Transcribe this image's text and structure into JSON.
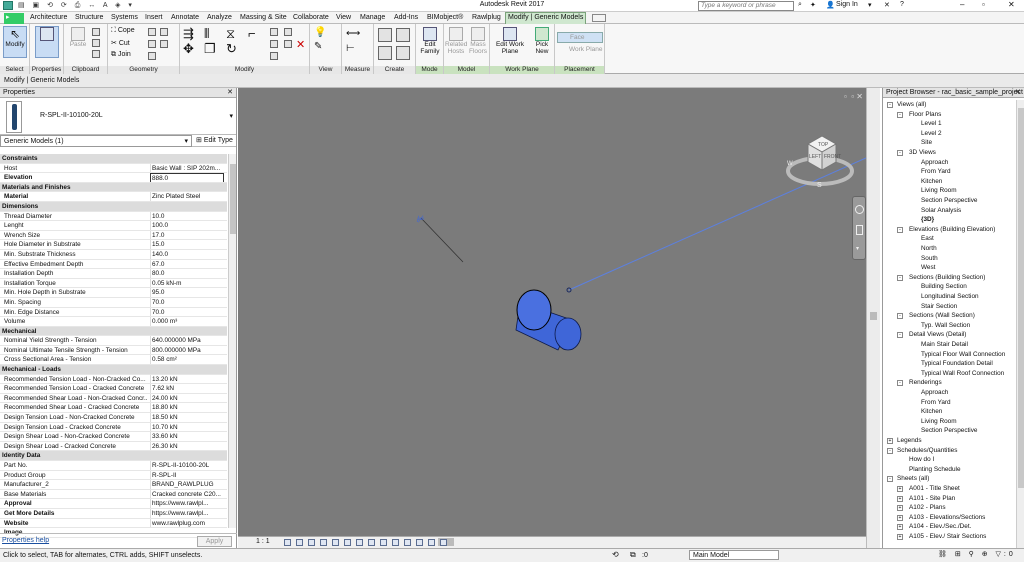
{
  "app_title": "Autodesk Revit 2017",
  "search_placeholder": "Type a keyword or phrase",
  "sign_in": "Sign In",
  "tabs": [
    "Architecture",
    "Structure",
    "Systems",
    "Insert",
    "Annotate",
    "Analyze",
    "Massing & Site",
    "Collaborate",
    "View",
    "Manage",
    "Add-Ins",
    "BIMobject®",
    "Rawlplug",
    "Modify | Generic Models"
  ],
  "ribbon": {
    "select_label": "Select",
    "modify_label": "Modify",
    "properties_label": "Properties",
    "paste_label": "Paste",
    "clipboard_label": "Clipboard",
    "cope_label": "Cope",
    "cut_label": "Cut",
    "join_label": "Join",
    "geometry_label": "Geometry",
    "modify_group_label": "Modify",
    "view_label": "View",
    "measure_label": "Measure",
    "create_label": "Create",
    "edit_family_label": "Edit Family",
    "mode_label": "Mode",
    "related_hosts_label": "Related Hosts",
    "mass_floors_label": "Mass Floors",
    "model_label": "Model",
    "edit_work_plane_label": "Edit Work Plane",
    "work_plane_label": "Work Plane",
    "pick_new_label": "Pick New",
    "face_label": "Face",
    "work_plane_opt_label": "Work Plane",
    "placement_label": "Placement"
  },
  "context_bar": "Modify | Generic Models",
  "properties": {
    "title": "Properties",
    "type_name": "R-SPL-II-10100-20L",
    "filter": "Generic Models (1)",
    "edit_type": "Edit Type",
    "rows": [
      {
        "k": "Constraints",
        "sec": true
      },
      {
        "k": "Host",
        "v": "Basic Wall : SIP 202m..."
      },
      {
        "k": "Elevation",
        "v": "888.0",
        "bold": true
      },
      {
        "k": "Materials and Finishes",
        "sec": true
      },
      {
        "k": "Material",
        "v": "Zinc Plated Steel",
        "bold": true
      },
      {
        "k": "Dimensions",
        "sec": true
      },
      {
        "k": "Thread Diameter",
        "v": "10.0"
      },
      {
        "k": "Lenght",
        "v": "100.0"
      },
      {
        "k": "Wrench Size",
        "v": "17.0"
      },
      {
        "k": "Hole Diameter in Substrate",
        "v": "15.0"
      },
      {
        "k": "Min. Substrate Thickness",
        "v": "140.0"
      },
      {
        "k": "Effective Embedment Depth",
        "v": "67.0"
      },
      {
        "k": "Installation Depth",
        "v": "80.0"
      },
      {
        "k": "Installation Torque",
        "v": "0.05 kN-m"
      },
      {
        "k": "Min. Hole Depth in Substrate",
        "v": "95.0"
      },
      {
        "k": "Min. Spacing",
        "v": "70.0"
      },
      {
        "k": "Min. Edge Distance",
        "v": "70.0"
      },
      {
        "k": "Volume",
        "v": "0.000 m³"
      },
      {
        "k": "Mechanical",
        "sec": true
      },
      {
        "k": "Nominal Yield Strength - Tension",
        "v": "640.000000 MPa"
      },
      {
        "k": "Nominal Ultimate Tensile Strength - Tension",
        "v": "800.000000 MPa"
      },
      {
        "k": "Cross Sectional Area - Tension",
        "v": "0.58 cm²"
      },
      {
        "k": "Mechanical - Loads",
        "sec": true
      },
      {
        "k": "Recommended Tension Load - Non-Cracked Co...",
        "v": "13.20 kN"
      },
      {
        "k": "Recommended Tension Load - Cracked Concrete",
        "v": "7.62 kN"
      },
      {
        "k": "Recommended Shear Load - Non-Cracked Concr...",
        "v": "24.00 kN"
      },
      {
        "k": "Recommended Shear Load - Cracked Concrete",
        "v": "18.80 kN"
      },
      {
        "k": "Design Tension Load - Non-Cracked Concrete",
        "v": "18.50 kN"
      },
      {
        "k": "Design Tension Load - Cracked Concrete",
        "v": "10.70 kN"
      },
      {
        "k": "Design Shear Load - Non-Cracked Concrete",
        "v": "33.60 kN"
      },
      {
        "k": "Design Shear Load - Cracked Concrete",
        "v": "26.30 kN"
      },
      {
        "k": "Identity Data",
        "sec": true
      },
      {
        "k": "Part No.",
        "v": "R-SPL-II-10100-20L"
      },
      {
        "k": "Product Group",
        "v": "R-SPL-II"
      },
      {
        "k": "Manufacturer_2",
        "v": "BRAND_RAWLPLUG"
      },
      {
        "k": "Base Materials",
        "v": "Cracked concrete C20..."
      },
      {
        "k": "Approval",
        "v": "https://www.rawlpl...",
        "bold": true
      },
      {
        "k": "Get More Details",
        "v": "https://www.rawlpl...",
        "bold": true
      },
      {
        "k": "Website",
        "v": "www.rawlplug.com",
        "bold": true
      },
      {
        "k": "Image",
        "v": "",
        "bold": true
      }
    ],
    "help": "Properties help",
    "apply": "Apply"
  },
  "browser": {
    "title": "Project Browser - rac_basic_sample_project",
    "items": [
      {
        "t": "Views (all)",
        "d": 0,
        "tog": "-"
      },
      {
        "t": "Floor Plans",
        "d": 1,
        "tog": "-"
      },
      {
        "t": "Level 1",
        "d": 2
      },
      {
        "t": "Level 2",
        "d": 2
      },
      {
        "t": "Site",
        "d": 2
      },
      {
        "t": "3D Views",
        "d": 1,
        "tog": "-"
      },
      {
        "t": "Approach",
        "d": 2
      },
      {
        "t": "From Yard",
        "d": 2
      },
      {
        "t": "Kitchen",
        "d": 2
      },
      {
        "t": "Living Room",
        "d": 2
      },
      {
        "t": "Section Perspective",
        "d": 2
      },
      {
        "t": "Solar Analysis",
        "d": 2
      },
      {
        "t": "{3D}",
        "d": 2,
        "bold": true
      },
      {
        "t": "Elevations (Building Elevation)",
        "d": 1,
        "tog": "-"
      },
      {
        "t": "East",
        "d": 2
      },
      {
        "t": "North",
        "d": 2
      },
      {
        "t": "South",
        "d": 2
      },
      {
        "t": "West",
        "d": 2
      },
      {
        "t": "Sections (Building Section)",
        "d": 1,
        "tog": "-"
      },
      {
        "t": "Building Section",
        "d": 2
      },
      {
        "t": "Longitudinal Section",
        "d": 2
      },
      {
        "t": "Stair Section",
        "d": 2
      },
      {
        "t": "Sections (Wall Section)",
        "d": 1,
        "tog": "-"
      },
      {
        "t": "Typ. Wall Section",
        "d": 2
      },
      {
        "t": "Detail Views (Detail)",
        "d": 1,
        "tog": "-"
      },
      {
        "t": "Main Stair Detail",
        "d": 2
      },
      {
        "t": "Typical Floor Wall Connection",
        "d": 2
      },
      {
        "t": "Typical Foundation Detail",
        "d": 2
      },
      {
        "t": "Typical Wall Roof Connection",
        "d": 2
      },
      {
        "t": "Renderings",
        "d": 1,
        "tog": "-"
      },
      {
        "t": "Approach",
        "d": 2
      },
      {
        "t": "From Yard",
        "d": 2
      },
      {
        "t": "Kitchen",
        "d": 2
      },
      {
        "t": "Living Room",
        "d": 2
      },
      {
        "t": "Section Perspective",
        "d": 2
      },
      {
        "t": "Legends",
        "d": 0,
        "tog": "+"
      },
      {
        "t": "Schedules/Quantities",
        "d": 0,
        "tog": "-"
      },
      {
        "t": "How do I",
        "d": 1
      },
      {
        "t": "Planting Schedule",
        "d": 1
      },
      {
        "t": "Sheets (all)",
        "d": 0,
        "tog": "-"
      },
      {
        "t": "A001 - Title Sheet",
        "d": 1,
        "tog": "+"
      },
      {
        "t": "A101 - Site Plan",
        "d": 1,
        "tog": "+"
      },
      {
        "t": "A102 - Plans",
        "d": 1,
        "tog": "+"
      },
      {
        "t": "A103 - Elevations/Sections",
        "d": 1,
        "tog": "+"
      },
      {
        "t": "A104 - Elev./Sec./Det.",
        "d": 1,
        "tog": "+"
      },
      {
        "t": "A105 - Elev./ Stair Sections",
        "d": 1,
        "tog": "+"
      }
    ]
  },
  "viewcube": {
    "top": "TOP",
    "left": "LEFT",
    "front": "FRONT",
    "compass_s": "S",
    "compass_w": "W"
  },
  "view_scale": "1 : 1",
  "status_text": "Click to select, TAB for alternates, CTRL adds, SHIFT unselects.",
  "status_zero": ":0",
  "main_model": "Main Model",
  "colors": {
    "accent_tab": "#cfe7cf",
    "canvas_bg": "#7b7b7b",
    "element_blue": "#3f66d8",
    "workplane_line": "#5c80e0"
  }
}
